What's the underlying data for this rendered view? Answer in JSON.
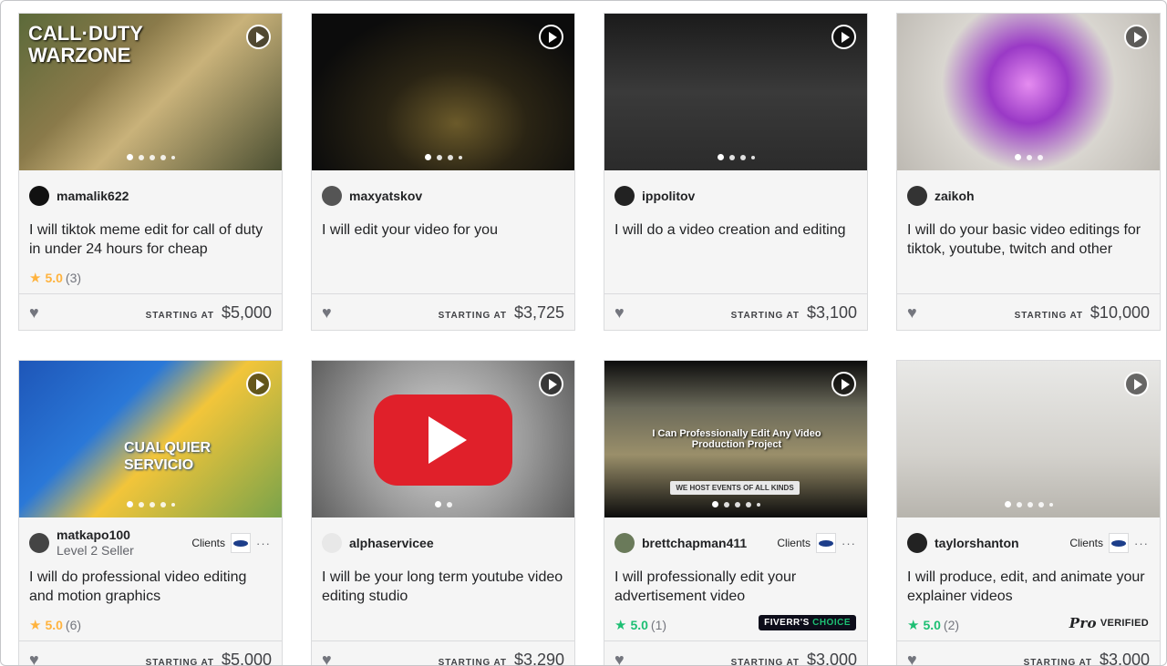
{
  "icons": {
    "play": "play-circle-icon",
    "heart": "heart-icon",
    "star": "star-icon",
    "more": "more-dots-icon"
  },
  "colors": {
    "star_gold": "#ffb33e",
    "star_green": "#1dbf73",
    "card_bg": "#f5f5f5"
  },
  "starting_label": "STARTING AT",
  "cards": [
    {
      "seller": "mamalik622",
      "level": "",
      "title": "I will tiktok meme edit for call of duty in under 24 hours for cheap",
      "rating": "5.0",
      "count": "(3)",
      "price": "$5,000",
      "star_color": "gold",
      "clients": "",
      "badge": "",
      "thumb_caption": "CALL·DUTY WARZONE",
      "dots": 5
    },
    {
      "seller": "maxyatskov",
      "level": "",
      "title": "I will edit your video for you",
      "rating": "",
      "count": "",
      "price": "$3,725",
      "star_color": "",
      "clients": "",
      "badge": "",
      "thumb_caption": "",
      "dots": 4
    },
    {
      "seller": "ippolitov",
      "level": "",
      "title": "I will do a video creation and editing",
      "rating": "",
      "count": "",
      "price": "$3,100",
      "star_color": "",
      "clients": "",
      "badge": "",
      "thumb_caption": "",
      "dots": 4
    },
    {
      "seller": "zaikoh",
      "level": "",
      "title": "I will do your basic video editings for tiktok, youtube, twitch and other",
      "rating": "",
      "count": "",
      "price": "$10,000",
      "star_color": "",
      "clients": "",
      "badge": "",
      "thumb_caption": "",
      "dots": 3
    },
    {
      "seller": "matkapo100",
      "level": "Level 2 Seller",
      "title": "I will do professional video editing and motion graphics",
      "rating": "5.0",
      "count": "(6)",
      "price": "$5,000",
      "star_color": "gold",
      "clients": "Clients",
      "badge": "",
      "thumb_caption": "CUALQUIER SERVICIO",
      "dots": 5
    },
    {
      "seller": "alphaservicee",
      "level": "",
      "title": "I will be your long term youtube video editing studio",
      "rating": "",
      "count": "",
      "price": "$3,290",
      "star_color": "",
      "clients": "",
      "badge": "",
      "thumb_caption": "",
      "dots": 2
    },
    {
      "seller": "brettchapman411",
      "level": "",
      "title": "I will professionally edit your advertisement video",
      "rating": "5.0",
      "count": "(1)",
      "price": "$3,000",
      "star_color": "green",
      "clients": "Clients",
      "badge": "fiverr",
      "thumb_caption": "I Can Professionally Edit Any Video Production Project",
      "thumb_sub": "WE HOST EVENTS OF ALL KINDS",
      "dots": 5
    },
    {
      "seller": "taylorshanton",
      "level": "",
      "title": "I will produce, edit, and animate your explainer videos",
      "rating": "5.0",
      "count": "(2)",
      "price": "$3,000",
      "star_color": "green",
      "clients": "Clients",
      "badge": "pro",
      "thumb_caption": "",
      "dots": 5
    }
  ],
  "badges": {
    "fiverr_a": "FIVERR'S",
    "fiverr_b": "CHOICE",
    "pro_mark": "Pro",
    "pro_label": "VERIFIED"
  }
}
